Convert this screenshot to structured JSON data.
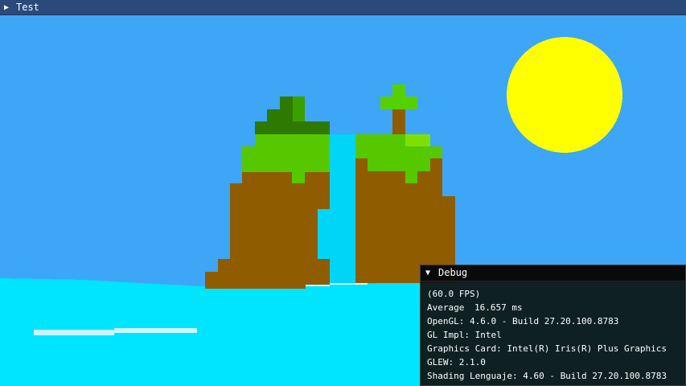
{
  "window": {
    "title": "Test",
    "collapse_icon": "triangle-right-icon"
  },
  "scene": {
    "colors": {
      "sky": "#3da6f7",
      "sun": "#ffff00",
      "water": "#00e5ff",
      "foam": "#c8f6ff",
      "grass_light": "#55c800",
      "grass_mid": "#3aa000",
      "grass_dark": "#2e7a00",
      "dirt": "#8f5c00",
      "waterfall": "#00d4f7",
      "trunk": "#8f5c00",
      "leaf": "#55d000"
    }
  },
  "debug": {
    "title": "Debug",
    "collapse_icon": "triangle-down-icon",
    "fps": "(60.0 FPS)",
    "average_label": "Average",
    "average_value": "16.657 ms",
    "opengl": "OpenGL: 4.6.0 - Build 27.20.100.8783",
    "gl_impl": "GL Impl: Intel",
    "graphics_card": "Graphics Card: Intel(R) Iris(R) Plus Graphics",
    "glew": "GLEW: 2.1.0",
    "shading": "Shading Lenguaje: 4.60 - Build 27.20.100.8783"
  }
}
